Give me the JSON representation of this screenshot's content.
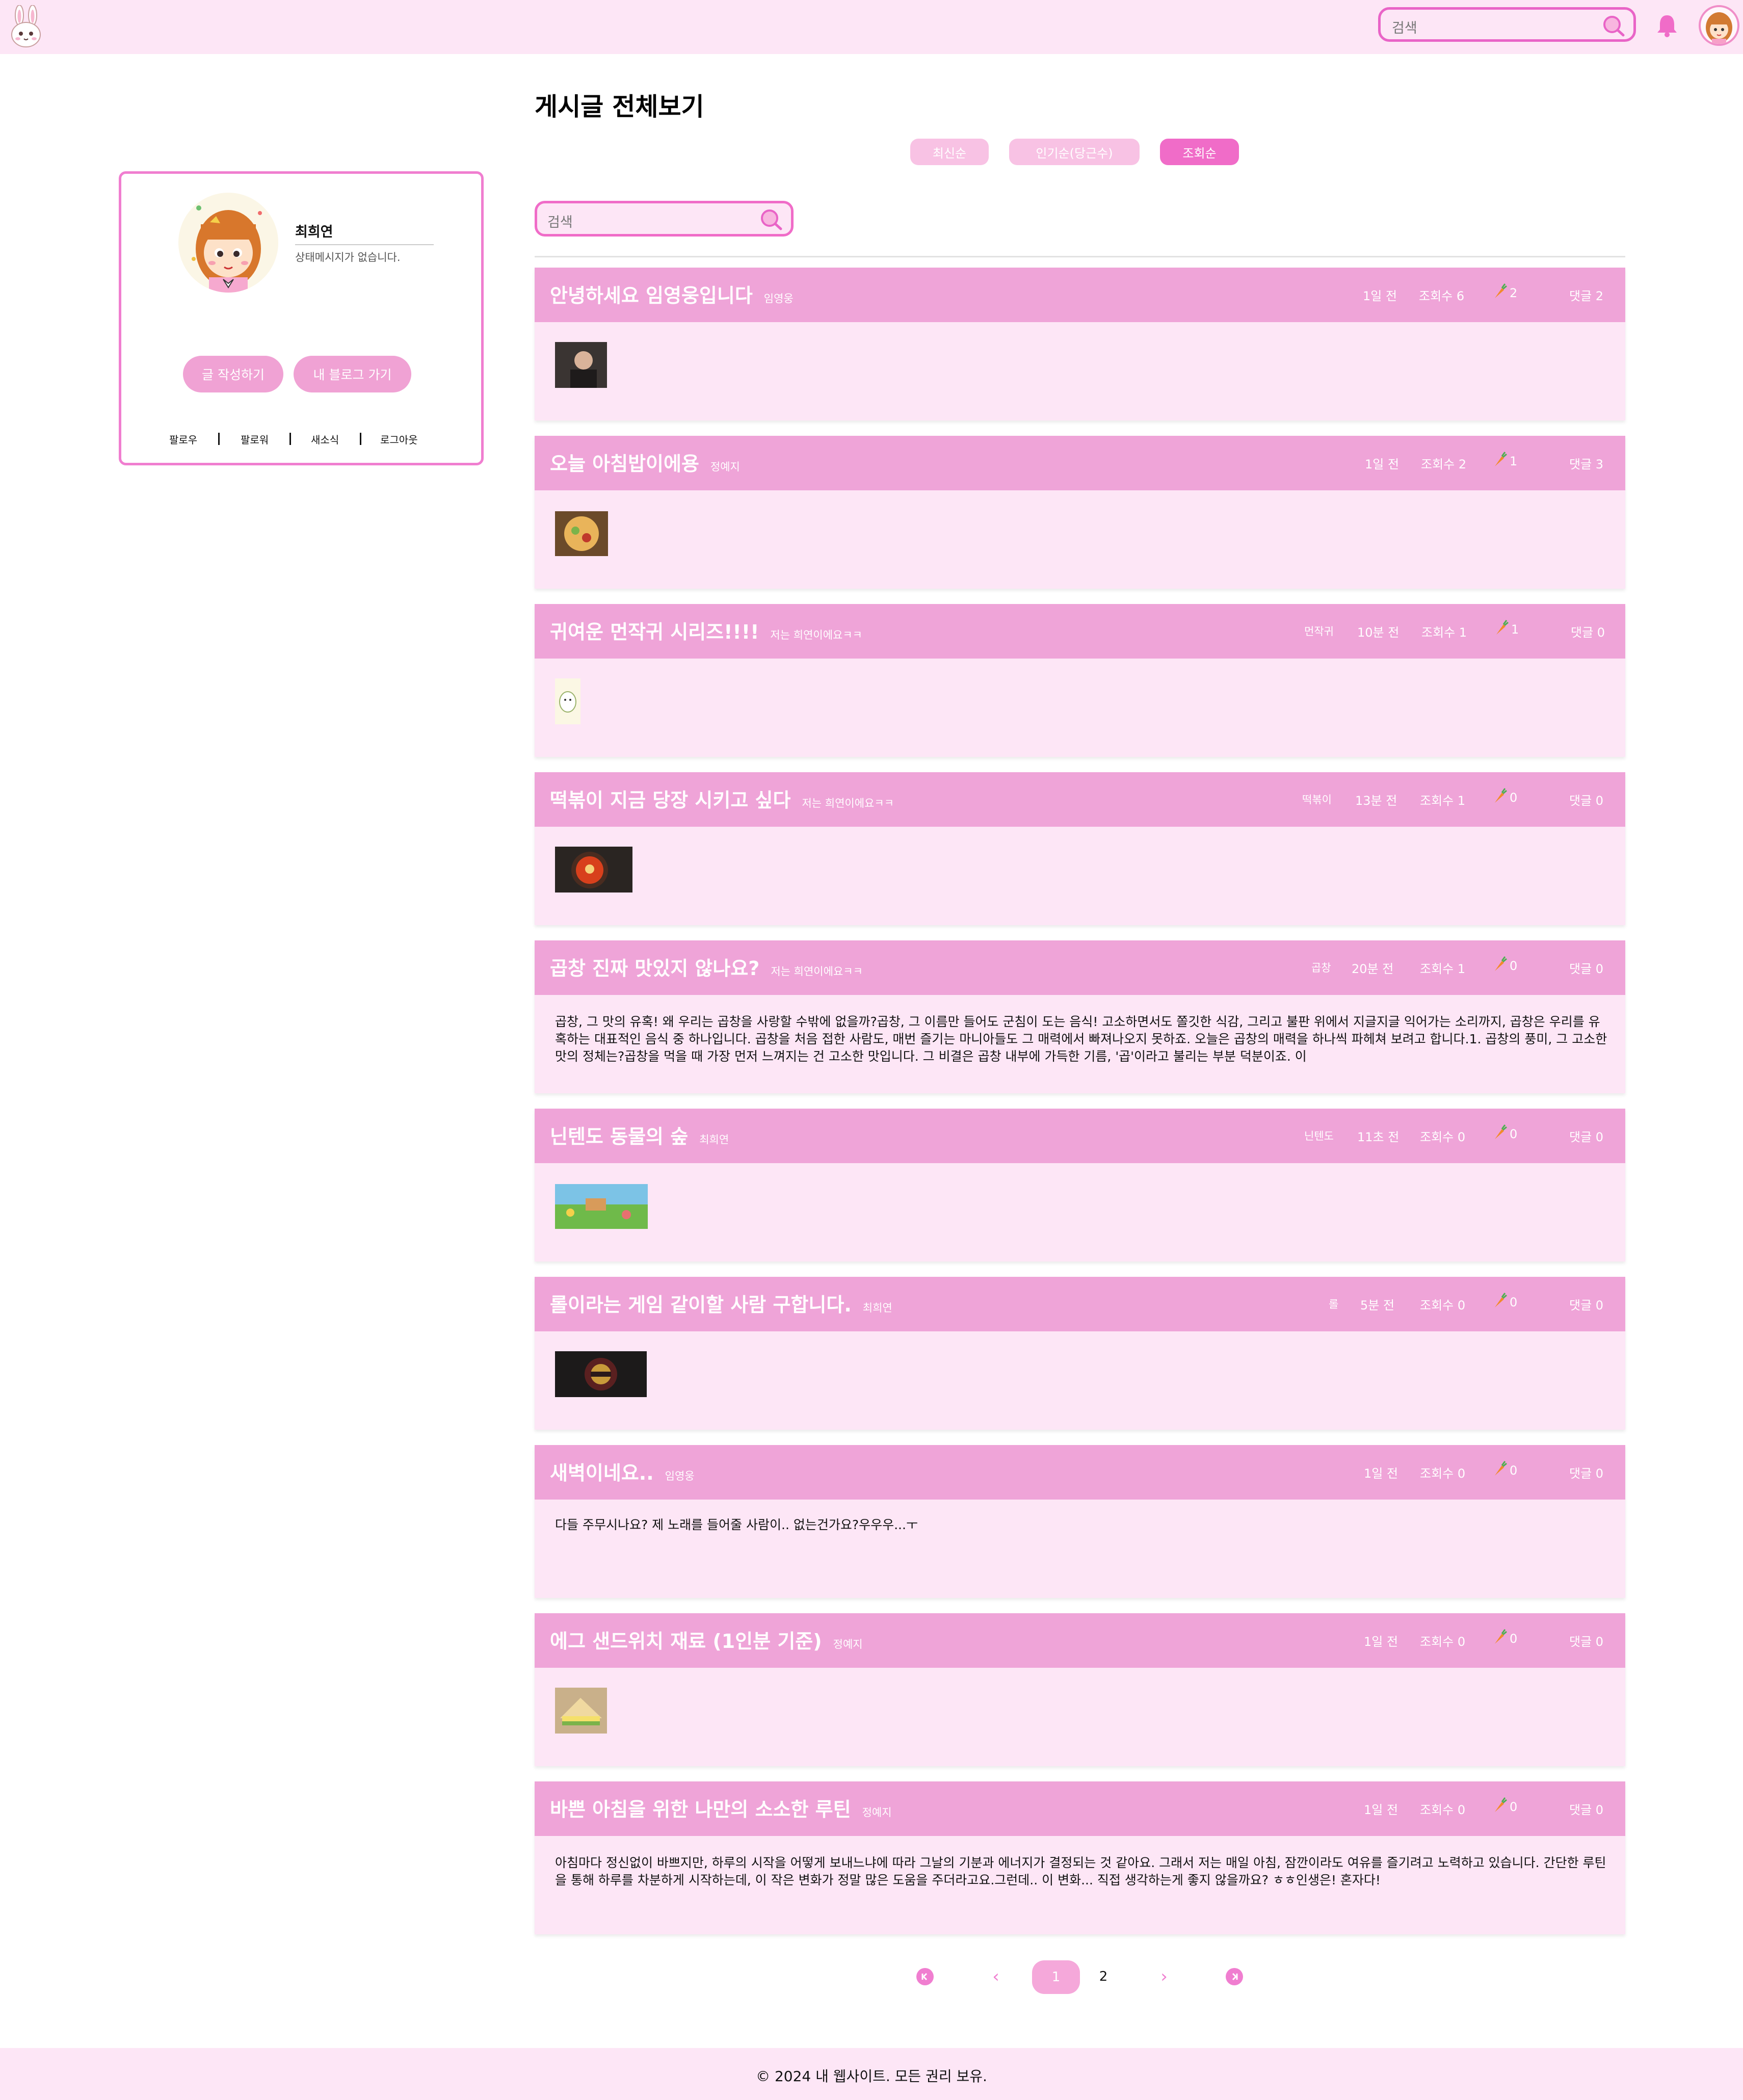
{
  "header": {
    "search_placeholder": "검색",
    "logo_icon": "rabbit-icon",
    "bell_icon": "bell-icon",
    "accent_color": "#e964c7",
    "background_color": "#fde6f6"
  },
  "profile": {
    "name": "최희연",
    "status": "상태메시지가 없습니다.",
    "write_button": "글 작성하기",
    "blog_button": "내 블로그 가기",
    "links": [
      "팔로우",
      "팔로워",
      "새소식",
      "로그아웃"
    ]
  },
  "main": {
    "title": "게시글 전체보기",
    "sort": {
      "newest": "최신순",
      "popular": "인기순(당근수)",
      "views": "조회순",
      "selected": "조회순"
    },
    "search_placeholder": "검색"
  },
  "posts": [
    {
      "title": "안녕하세요 임영웅입니다",
      "author": "임영웅",
      "tag": "",
      "time": "1일 전",
      "views": "조회수 6",
      "carrots": "2",
      "comments": "댓글 2",
      "thumbnail": "portrait-photo"
    },
    {
      "title": "오늘 아침밥이에용",
      "author": "정예지",
      "tag": "",
      "time": "1일 전",
      "views": "조회수 2",
      "carrots": "1",
      "comments": "댓글 3",
      "thumbnail": "food-photo"
    },
    {
      "title": "귀여운 먼작귀 시리즈!!!!",
      "author": "저는 희연이에요ㅋㅋ",
      "tag": "먼작귀",
      "time": "10분 전",
      "views": "조회수 1",
      "carrots": "1",
      "comments": "댓글 0",
      "thumbnail": "character-drawing"
    },
    {
      "title": "떡볶이 지금 당장 시키고 싶다",
      "author": "저는 희연이에요ㅋㅋ",
      "tag": "떡볶이",
      "time": "13분 전",
      "views": "조회수 1",
      "carrots": "0",
      "comments": "댓글 0",
      "thumbnail": "tteokbokki-photo"
    },
    {
      "title": "곱창 진짜 맛있지 않나요?",
      "author": "저는 희연이에요ㅋㅋ",
      "tag": "곱창",
      "time": "20분 전",
      "views": "조회수 1",
      "carrots": "0",
      "comments": "댓글 0",
      "text": "곱창, 그 맛의 유혹! 왜 우리는 곱창을 사랑할 수밖에 없을까?곱창, 그 이름만 들어도 군침이 도는 음식! 고소하면서도 쫄깃한 식감, 그리고 불판 위에서 지글지글 익어가는 소리까지, 곱창은 우리를 유혹하는 대표적인 음식 중 하나입니다. 곱창을 처음 접한 사람도, 매번 즐기는 마니아들도 그 매력에서 빠져나오지 못하죠. 오늘은 곱창의 매력을 하나씩 파헤쳐 보려고 합니다.1. 곱창의 풍미, 그 고소한 맛의 정체는?곱창을 먹을 때 가장 먼저 느껴지는 건 고소한 맛입니다. 그 비결은 곱창 내부에 가득한 기름, '곱'이라고 불리는 부분 덕분이죠. 이"
    },
    {
      "title": "닌텐도 동물의 숲",
      "author": "최희연",
      "tag": "닌텐도",
      "time": "11초 전",
      "views": "조회수 0",
      "carrots": "0",
      "comments": "댓글 0",
      "thumbnail": "game-screenshot"
    },
    {
      "title": "롤이라는 게임 같이할 사람 구합니다.",
      "author": "최희연",
      "tag": "롤",
      "time": "5분 전",
      "views": "조회수 0",
      "carrots": "0",
      "comments": "댓글 0",
      "thumbnail": "game-logo"
    },
    {
      "title": "새벽이네요..",
      "author": "임영웅",
      "tag": "",
      "time": "1일 전",
      "views": "조회수 0",
      "carrots": "0",
      "comments": "댓글 0",
      "text": "다들 주무시나요? 제 노래를 들어줄 사람이.. 없는건가요?우우우...ㅜ"
    },
    {
      "title": "에그 샌드위치 재료 (1인분 기준)",
      "author": "정예지",
      "tag": "",
      "time": "1일 전",
      "views": "조회수 0",
      "carrots": "0",
      "comments": "댓글 0",
      "thumbnail": "sandwich-photo"
    },
    {
      "title": "바쁜 아침을 위한 나만의 소소한 루틴",
      "author": "정예지",
      "tag": "",
      "time": "1일 전",
      "views": "조회수 0",
      "carrots": "0",
      "comments": "댓글 0",
      "text": "아침마다 정신없이 바쁘지만, 하루의 시작을 어떻게 보내느냐에 따라 그날의 기분과 에너지가 결정되는 것 같아요. 그래서 저는 매일 아침, 잠깐이라도 여유를 즐기려고 노력하고 있습니다. 간단한 루틴을 통해 하루를 차분하게 시작하는데, 이 작은 변화가 정말 많은 도움을 주더라고요.그런데.. 이 변화... 직접 생각하는게 좋지 않을까요? ㅎㅎ인생은! 혼자다!"
    }
  ],
  "pagination": {
    "pages": [
      "1",
      "2"
    ],
    "current": "1",
    "prev": "‹",
    "next": "›"
  },
  "footer": {
    "text": "© 2024 내 웹사이트. 모든 권리 보유."
  }
}
